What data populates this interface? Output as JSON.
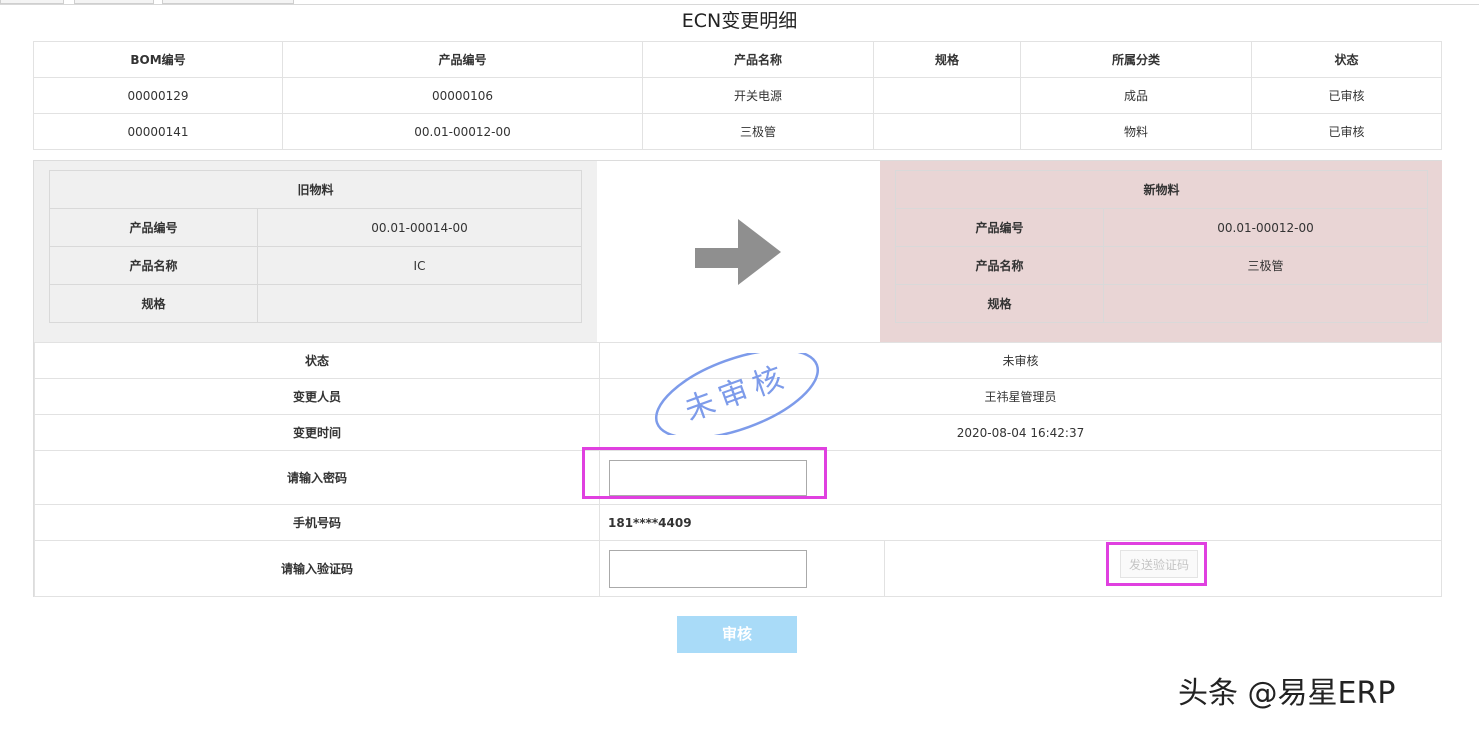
{
  "page": {
    "title": "ECN变更明细"
  },
  "bom_table": {
    "headers": [
      "BOM编号",
      "产品编号",
      "产品名称",
      "规格",
      "所属分类",
      "状态"
    ],
    "rows": [
      [
        "00000129",
        "00000106",
        "开关电源",
        "",
        "成品",
        "已审核"
      ],
      [
        "00000141",
        "00.01-00012-00",
        "三极管",
        "",
        "物料",
        "已审核"
      ]
    ]
  },
  "old_material": {
    "title": "旧物料",
    "rows": [
      {
        "label": "产品编号",
        "value": "00.01-00014-00"
      },
      {
        "label": "产品名称",
        "value": "IC"
      },
      {
        "label": "规格",
        "value": ""
      }
    ]
  },
  "new_material": {
    "title": "新物料",
    "rows": [
      {
        "label": "产品编号",
        "value": "00.01-00012-00"
      },
      {
        "label": "产品名称",
        "value": "三极管"
      },
      {
        "label": "规格",
        "value": ""
      }
    ]
  },
  "details": {
    "status_label": "状态",
    "status_value": "未审核",
    "changer_label": "变更人员",
    "changer_value": "王祎星管理员",
    "time_label": "变更时间",
    "time_value": "2020-08-04 16:42:37",
    "password_label": "请输入密码",
    "password_value": "",
    "phone_label": "手机号码",
    "phone_value": "181****4409",
    "code_label": "请输入验证码",
    "code_value": "",
    "send_code_label": "发送验证码"
  },
  "stamp": {
    "text": "未审核",
    "color": "#7d9bea"
  },
  "actions": {
    "submit_label": "审核"
  },
  "watermark": {
    "text": "头条 @易星ERP"
  },
  "colors": {
    "new_panel_bg": "#e9d5d5",
    "old_panel_bg": "#f0f0f0",
    "highlight": "#e040e0",
    "submit_bg": "#a9dbf8"
  }
}
